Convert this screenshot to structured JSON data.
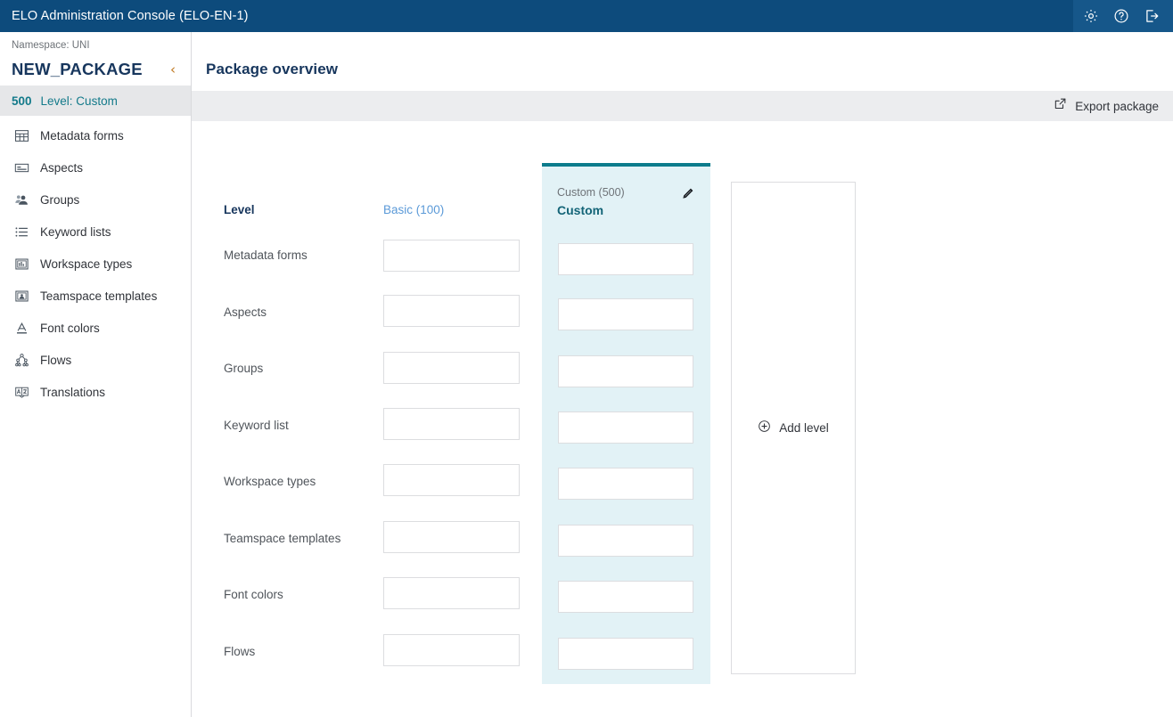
{
  "appbar": {
    "title": "ELO Administration Console (ELO-EN-1)",
    "actions": [
      {
        "name": "settings-icon",
        "label": "Settings"
      },
      {
        "name": "help-icon",
        "label": "Help"
      },
      {
        "name": "logout-icon",
        "label": "Log out"
      }
    ]
  },
  "sidebar": {
    "namespace_label": "Namespace: UNI",
    "package_name": "NEW_PACKAGE",
    "collapse_glyph": "‹",
    "selected_level": {
      "number": "500",
      "label": "Level: Custom"
    },
    "items": [
      {
        "label": "Metadata forms",
        "icon": "table-icon"
      },
      {
        "label": "Aspects",
        "icon": "card-icon"
      },
      {
        "label": "Groups",
        "icon": "users-icon"
      },
      {
        "label": "Keyword lists",
        "icon": "list-icon"
      },
      {
        "label": "Workspace types",
        "icon": "workspace-icon"
      },
      {
        "label": "Teamspace templates",
        "icon": "teamspace-icon"
      },
      {
        "label": "Font colors",
        "icon": "font-color-icon"
      },
      {
        "label": "Flows",
        "icon": "flow-icon"
      },
      {
        "label": "Translations",
        "icon": "translations-icon"
      }
    ]
  },
  "main": {
    "title": "Package overview",
    "toolbar": {
      "export_label": "Export package",
      "export_icon": "external-link-icon"
    },
    "matrix": {
      "level_header_label": "Level",
      "row_labels": [
        "Metadata forms",
        "Aspects",
        "Groups",
        "Keyword list",
        "Workspace types",
        "Teamspace templates",
        "Font colors",
        "Flows"
      ],
      "basic_column": {
        "header": "Basic (100)",
        "values": [
          "",
          "",
          "",
          "",
          "",
          "",
          "",
          ""
        ]
      },
      "custom_column": {
        "key": "Custom (500)",
        "name": "Custom",
        "edit_icon": "pencil-icon",
        "values": [
          "",
          "",
          "",
          "",
          "",
          "",
          "",
          ""
        ]
      },
      "add_column": {
        "label": "Add level",
        "icon": "plus-circle-icon"
      }
    }
  },
  "colors": {
    "appbar_bg": "#0d4b7c",
    "appbar_actions_bg": "#16578a",
    "accent_teal": "#0c7c8c",
    "custom_panel_bg": "#e2f2f6",
    "toolbar_bg": "#ecedef",
    "link_blue": "#5b9ad8",
    "heading_navy": "#17365d",
    "collapse_orange": "#c07820"
  }
}
